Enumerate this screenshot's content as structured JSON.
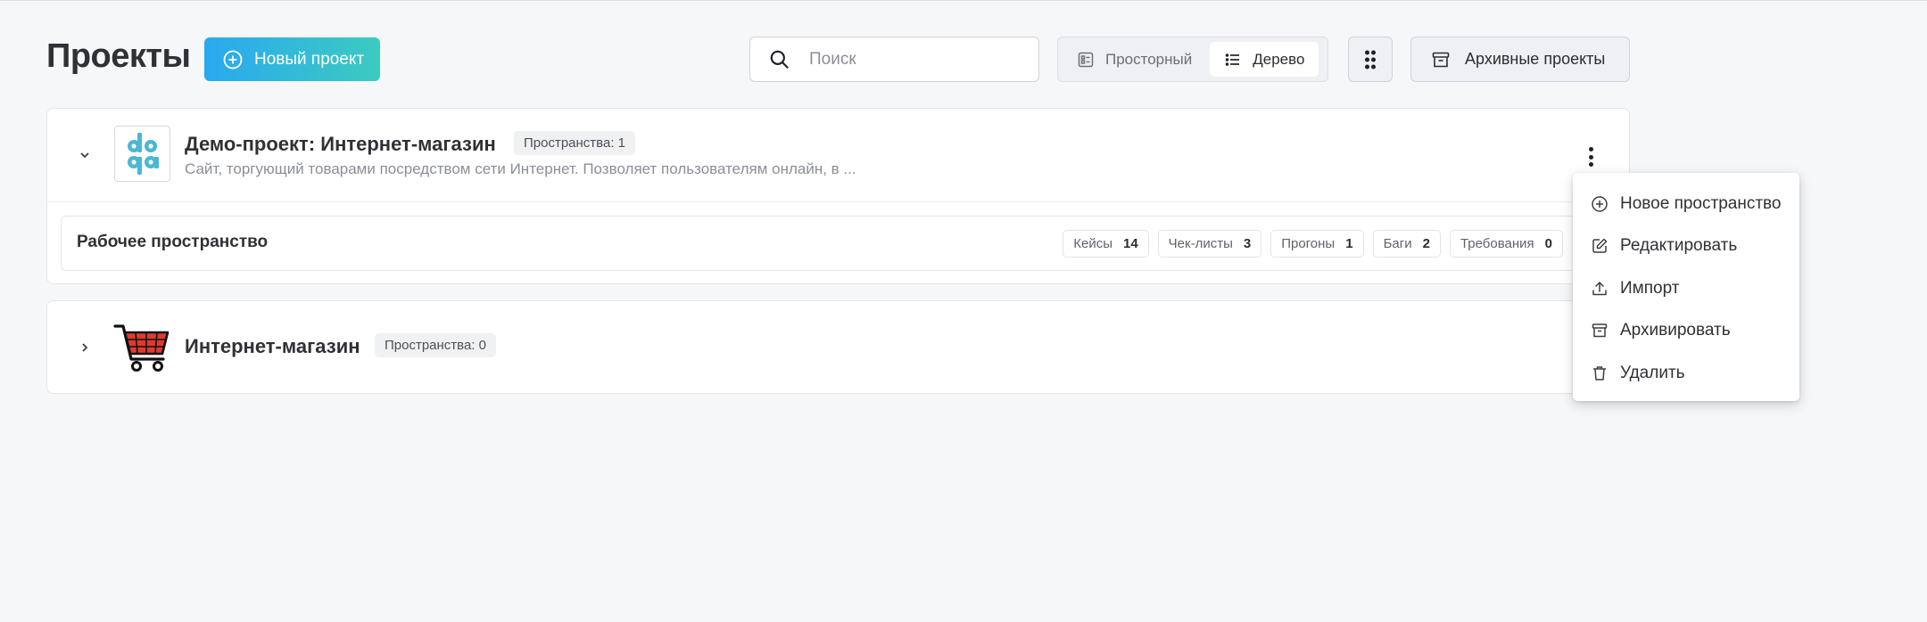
{
  "header": {
    "title": "Проекты",
    "new_project_label": "Новый проект",
    "search_placeholder": "Поиск",
    "view_modes": {
      "spacious": "Просторный",
      "tree": "Дерево",
      "active": "tree"
    },
    "archive_label": "Архивные проекты"
  },
  "projects": [
    {
      "name": "Демо-проект: Интернет-магазин",
      "spaces_badge": "Пространства: 1",
      "description": "Сайт, торгующий товарами посредством сети Интернет. Позволяет пользователям онлайн, в ...",
      "expanded": true,
      "logo": "doqa-logo",
      "workspaces": [
        {
          "name": "Рабочее пространство",
          "stats": [
            {
              "label": "Кейсы",
              "value": "14"
            },
            {
              "label": "Чек-листы",
              "value": "3"
            },
            {
              "label": "Прогоны",
              "value": "1"
            },
            {
              "label": "Баги",
              "value": "2"
            },
            {
              "label": "Требования",
              "value": "0"
            }
          ]
        }
      ]
    },
    {
      "name": "Интернет-магазин",
      "spaces_badge": "Пространства: 0",
      "expanded": false,
      "logo": "shopping-cart-logo"
    }
  ],
  "context_menu": {
    "items": [
      {
        "label": "Новое пространство",
        "icon": "plus-circle-icon"
      },
      {
        "label": "Редактировать",
        "icon": "edit-icon"
      },
      {
        "label": "Импорт",
        "icon": "upload-icon"
      },
      {
        "label": "Архивировать",
        "icon": "archive-icon"
      },
      {
        "label": "Удалить",
        "icon": "trash-icon"
      }
    ]
  },
  "colors": {
    "accent_gradient_start": "#2aa8f0",
    "accent_gradient_end": "#3ccbc0",
    "background": "#f6f7f9",
    "logo_teal": "#4ab7d4",
    "cart_red": "#e03a30"
  }
}
